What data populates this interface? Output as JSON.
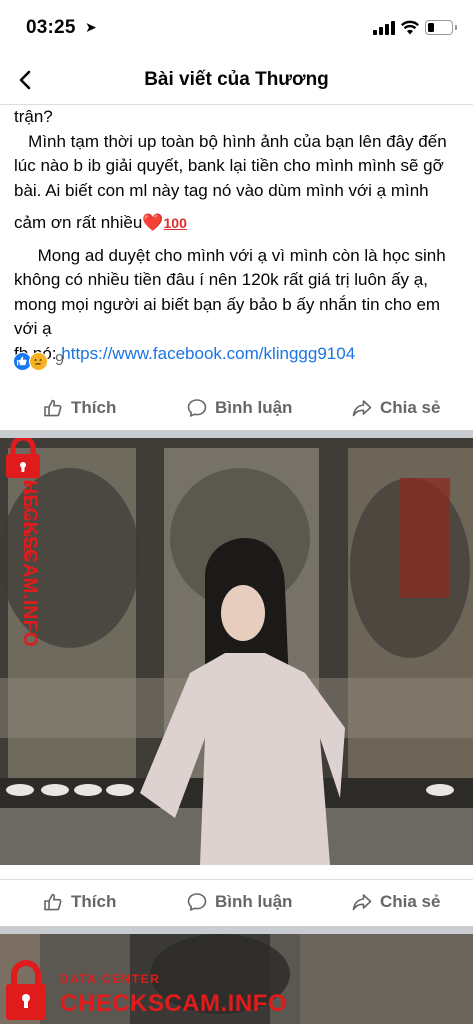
{
  "status_bar": {
    "time": "03:25"
  },
  "nav": {
    "title": "Bài viết của Thương"
  },
  "post": {
    "lines": [
      "trận?",
      "   Mình tạm thời up toàn bộ hình ảnh của bạn lên đây đến",
      "lúc nào b ib giải quyết, bank lại tiền cho mình mình sẽ gỡ",
      "bài. Ai biết con ml này tag nó vào dùm mình với ạ mình",
      "cảm ơn rất nhiều",
      "     Mong ad duyệt cho mình với ạ vì mình còn là học sinh",
      "không có nhiều tiền đâu í nên 120k rất giá trị luôn ấy ạ,",
      "mong mọi người ai biết bạn ấy bảo b ấy nhắn tin cho em",
      "với ạ"
    ],
    "fb_label": "fb nó: ",
    "fb_link": "https://www.facebook.com/klinggg9104",
    "emoji_heart": "❤️",
    "emoji_100": "100",
    "reaction_count": "9"
  },
  "actions": {
    "like": "Thích",
    "comment": "Bình luận",
    "share": "Chia sẻ"
  },
  "watermark": {
    "line1": "DATA CENTER",
    "line2": "CHECKSCAM.INFO"
  },
  "colors": {
    "accent": "#1877f2",
    "link": "#1b74e4",
    "watermark": "#e01b1b",
    "muted": "#65676b"
  }
}
